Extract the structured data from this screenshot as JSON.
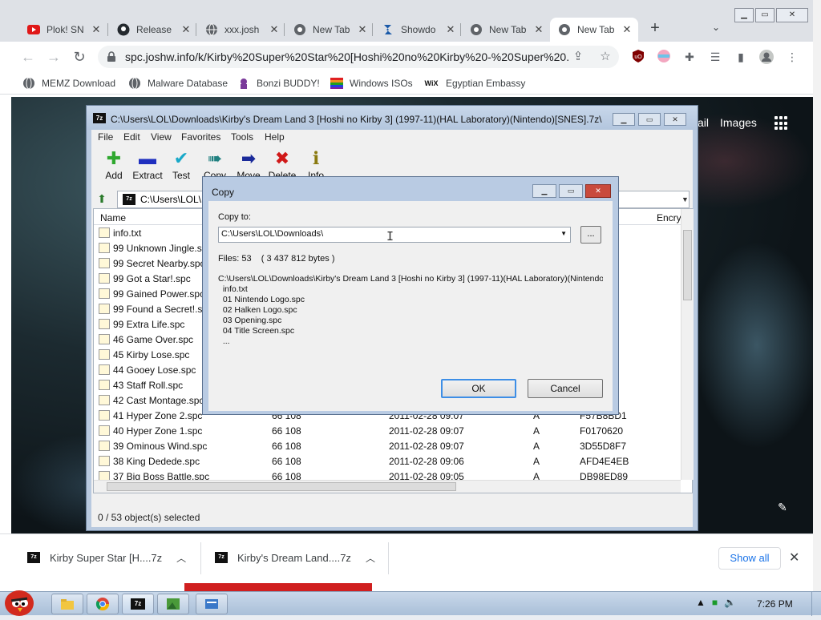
{
  "browser": {
    "tabs": [
      {
        "label": "Plok! SN",
        "icon": "youtube-icon",
        "active": false
      },
      {
        "label": "Release",
        "icon": "github-icon",
        "active": false
      },
      {
        "label": "xxx.josh",
        "icon": "globe-icon",
        "active": false
      },
      {
        "label": "New Tab",
        "icon": "chrome-icon",
        "active": false
      },
      {
        "label": "Showdo",
        "icon": "showdown-icon",
        "active": false
      },
      {
        "label": "New Tab",
        "icon": "chrome-icon",
        "active": false
      },
      {
        "label": "New Tab",
        "icon": "chrome-icon",
        "active": true
      }
    ],
    "url": "spc.joshw.info/k/Kirby%20Super%20Star%20[Hoshi%20no%20Kirby%20-%20Super%20...",
    "bookmarks": [
      {
        "label": "MEMZ Download",
        "icon": "globe-icon"
      },
      {
        "label": "Malware Database",
        "icon": "globe-icon"
      },
      {
        "label": "Bonzi BUDDY!",
        "icon": "bonzi-icon"
      },
      {
        "label": "Windows ISOs",
        "icon": "windows-flag-icon"
      },
      {
        "label": "Egyptian Embassy",
        "icon": "wix-icon"
      }
    ],
    "google_links": {
      "mail": "ail",
      "images": "Images"
    },
    "downloads": [
      {
        "label": "Kirby Super Star [H....7z"
      },
      {
        "label": "Kirby's Dream Land....7z"
      }
    ],
    "show_all": "Show all"
  },
  "zip": {
    "title": "C:\\Users\\LOL\\Downloads\\Kirby's Dream Land 3 [Hoshi no Kirby 3] (1997-11)(HAL Laboratory)(Nintendo)[SNES].7z\\",
    "menu": [
      "File",
      "Edit",
      "View",
      "Favorites",
      "Tools",
      "Help"
    ],
    "tools": [
      {
        "label": "Add",
        "color": "#2fa82f"
      },
      {
        "label": "Extract",
        "color": "#1f2fbf"
      },
      {
        "label": "Test",
        "color": "#18a8c8"
      },
      {
        "label": "Copy",
        "color": "#208080"
      },
      {
        "label": "Move",
        "color": "#1a2a9a"
      },
      {
        "label": "Delete",
        "color": "#d01818"
      },
      {
        "label": "Info",
        "color": "#8a7a10"
      }
    ],
    "address": "C:\\Users\\LOL\\D",
    "columns": {
      "name": "Name",
      "crc": "Encry"
    },
    "files": [
      {
        "name": "info.txt",
        "size": "",
        "date": "",
        "attr": "",
        "crc": ""
      },
      {
        "name": "99 Unknown Jingle.spc",
        "size": "",
        "date": "",
        "attr": "",
        "crc": ""
      },
      {
        "name": "99 Secret Nearby.spc",
        "size": "",
        "date": "",
        "attr": "",
        "crc": ""
      },
      {
        "name": "99 Got a Star!.spc",
        "size": "",
        "date": "",
        "attr": "",
        "crc": ""
      },
      {
        "name": "99 Gained Power.spc",
        "size": "",
        "date": "",
        "attr": "",
        "crc": ""
      },
      {
        "name": "99 Found a Secret!.spc",
        "size": "",
        "date": "",
        "attr": "",
        "crc": ""
      },
      {
        "name": "99 Extra Life.spc",
        "size": "",
        "date": "",
        "attr": "",
        "crc": ""
      },
      {
        "name": "46 Game Over.spc",
        "size": "",
        "date": "",
        "attr": "",
        "crc": ""
      },
      {
        "name": "45 Kirby Lose.spc",
        "size": "",
        "date": "",
        "attr": "",
        "crc": ""
      },
      {
        "name": "44 Gooey Lose.spc",
        "size": "",
        "date": "",
        "attr": "",
        "crc": ""
      },
      {
        "name": "43 Staff Roll.spc",
        "size": "",
        "date": "",
        "attr": "",
        "crc": ""
      },
      {
        "name": "42 Cast Montage.spc",
        "size": "",
        "date": "",
        "attr": "",
        "crc": ""
      },
      {
        "name": "41 Hyper Zone 2.spc",
        "size": "66 108",
        "date": "2011-02-28 09:07",
        "attr": "A",
        "crc": "F57B8BD1"
      },
      {
        "name": "40 Hyper Zone 1.spc",
        "size": "66 108",
        "date": "2011-02-28 09:07",
        "attr": "A",
        "crc": "F0170620"
      },
      {
        "name": "39 Ominous Wind.spc",
        "size": "66 108",
        "date": "2011-02-28 09:07",
        "attr": "A",
        "crc": "3D55D8F7"
      },
      {
        "name": "38 King Dedede.spc",
        "size": "66 108",
        "date": "2011-02-28 09:06",
        "attr": "A",
        "crc": "AFD4E4EB"
      },
      {
        "name": "37 Big Boss Battle.spc",
        "size": "66 108",
        "date": "2011-02-28 09:05",
        "attr": "A",
        "crc": "DB98ED89"
      }
    ],
    "status": "0 / 53 object(s) selected"
  },
  "copy_dialog": {
    "title": "Copy",
    "copy_to_label": "Copy to:",
    "path": "C:\\Users\\LOL\\Downloads\\",
    "browse": "...",
    "files_info": "Files: 53    ( 3 437 812 bytes )",
    "detail": [
      "C:\\Users\\LOL\\Downloads\\Kirby's Dream Land 3 [Hoshi no Kirby 3] (1997-11)(HAL Laboratory)(Nintendo",
      "  info.txt",
      "  01 Nintendo Logo.spc",
      "  02 Halken Logo.spc",
      "  03 Opening.spc",
      "  04 Title Screen.spc",
      "  ..."
    ],
    "ok": "OK",
    "cancel": "Cancel"
  },
  "taskbar": {
    "clock": "7:26 PM"
  }
}
